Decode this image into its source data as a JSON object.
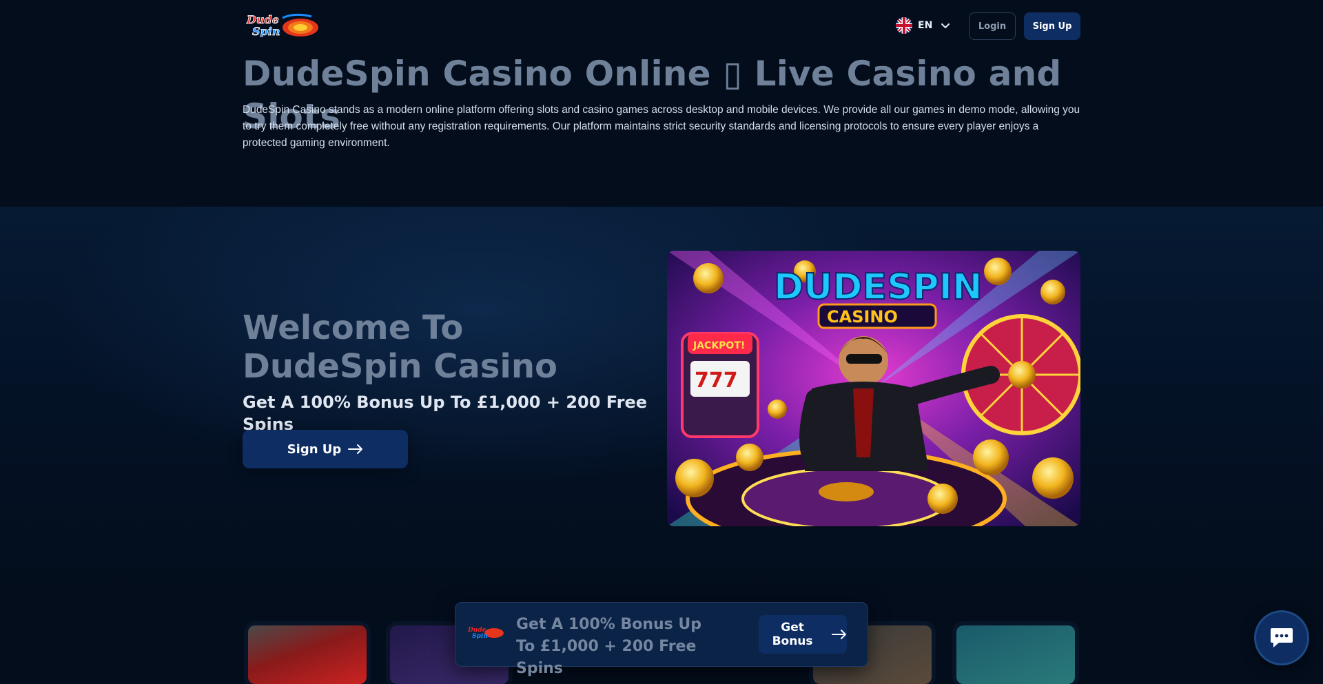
{
  "header": {
    "logo_text": "DudeSpin",
    "language": "EN",
    "login_label": "Login",
    "signup_label": "Sign Up"
  },
  "intro": {
    "title": "DudeSpin Casino Online ▯ Live Casino and Slots",
    "text": "DudeSpin Casino stands as a modern online platform offering slots and casino games across desktop and mobile devices. We provide all our games in demo mode, allowing you to try them completely free without any registration requirements. Our platform maintains strict security standards and licensing protocols to ensure every player enjoys a protected gaming environment."
  },
  "hero": {
    "title": "Welcome To DudeSpin Casino",
    "bonus": "Get A 100% Bonus Up To £1,000 + 200 Free Spins",
    "cta_label": "Sign Up",
    "image_title": "DUDESPIN",
    "image_subtitle": "CASINO",
    "image_jackpot": "JACKPOT!"
  },
  "sticky_bar": {
    "text": "Get A 100% Bonus Up To £1,000 + 200 Free Spins",
    "cta_label": "Get Bonus"
  },
  "colors": {
    "background": "#030d1c",
    "accent": "#0e2d63",
    "heading": "#6f8099"
  },
  "icons": {
    "language_flag": "uk-flag-icon",
    "dropdown": "chevron-down-icon",
    "arrow": "arrow-right-icon",
    "chat": "chat-icon"
  }
}
